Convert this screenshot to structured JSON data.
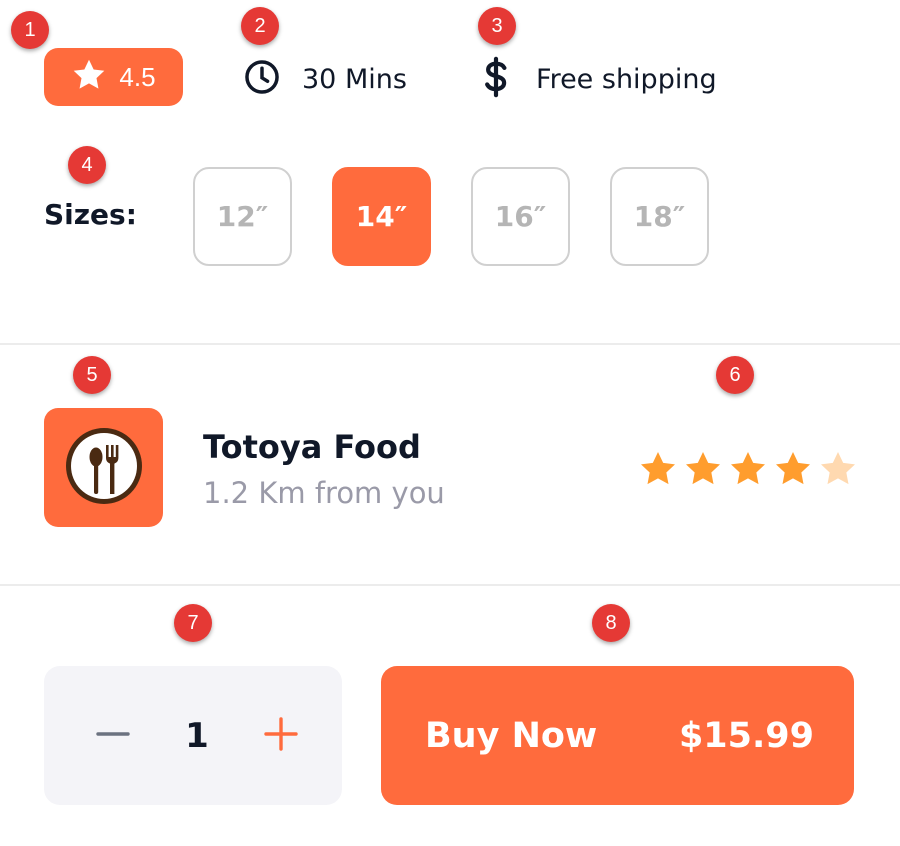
{
  "colors": {
    "accent": "#ff6b3d",
    "marker": "#e53935",
    "star": "#ff9d2e",
    "star_empty": "#ffd9b0"
  },
  "markers": [
    "1",
    "2",
    "3",
    "4",
    "5",
    "6",
    "7",
    "8"
  ],
  "product_info": {
    "rating": {
      "icon": "star-icon",
      "value": "4.5"
    },
    "delivery_time": {
      "icon": "clock-icon",
      "text": "30 Mins"
    },
    "shipping": {
      "icon": "dollar-icon",
      "text": "Free shipping"
    }
  },
  "sizes": {
    "label": "Sizes:",
    "options": [
      "12″",
      "14″",
      "16″",
      "18″"
    ],
    "selected": "14″"
  },
  "store": {
    "logo_icon": "spoon-fork-icon",
    "name": "Totoya Food",
    "distance": "1.2 Km from you",
    "rating_stars": 4,
    "rating_max": 5
  },
  "cart": {
    "decrement_icon": "minus-icon",
    "quantity": "1",
    "increment_icon": "plus-icon",
    "buy_label": "Buy Now",
    "price": "$15.99"
  }
}
